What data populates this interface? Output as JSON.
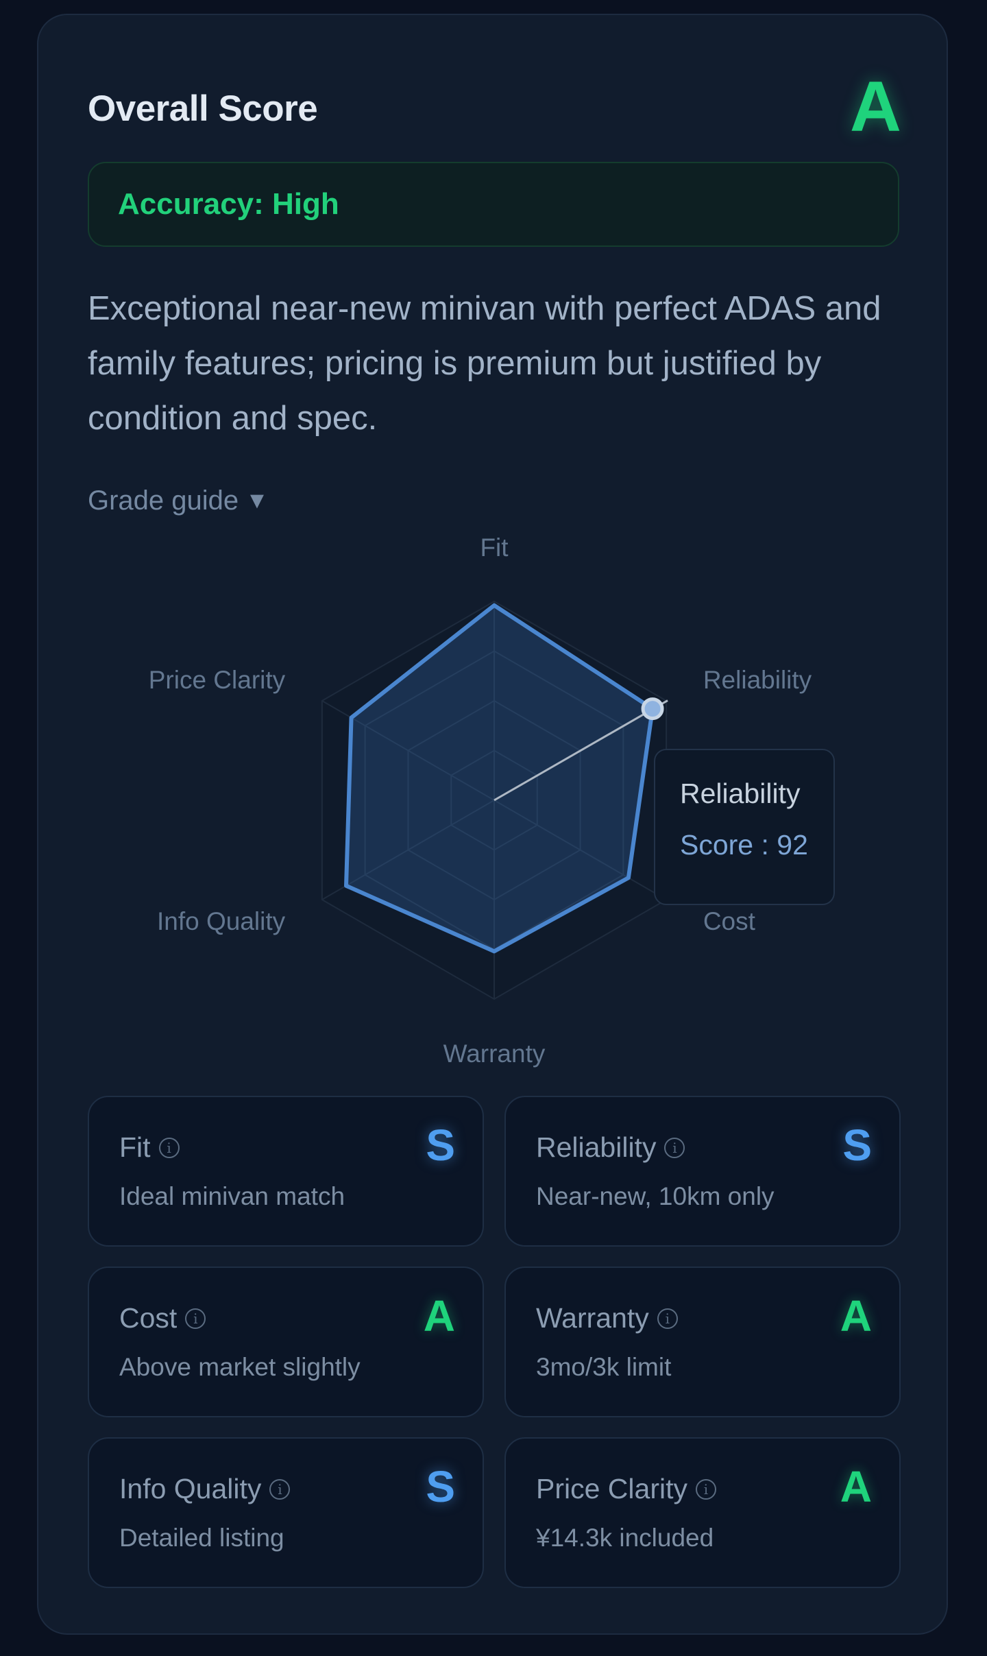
{
  "overall": {
    "title": "Overall Score",
    "grade": "A",
    "accuracy": "Accuracy: High",
    "summary": "Exceptional near-new minivan with perfect ADAS and family features; pricing is premium but justified by condition and spec.",
    "grade_guide_label": "Grade guide",
    "grade_guide_caret": "▼"
  },
  "chart_data": {
    "type": "radar",
    "axes": [
      "Fit",
      "Reliability",
      "Cost",
      "Warranty",
      "Info Quality",
      "Price Clarity"
    ],
    "values": [
      98,
      92,
      78,
      76,
      86,
      83
    ],
    "max": 100,
    "rings": 4,
    "active_point": "Reliability"
  },
  "tooltip": {
    "title": "Reliability",
    "score_text": "Score : 92"
  },
  "criteria": [
    {
      "name": "Fit",
      "desc": "Ideal minivan match",
      "grade": "S"
    },
    {
      "name": "Reliability",
      "desc": "Near-new, 10km only",
      "grade": "S"
    },
    {
      "name": "Cost",
      "desc": "Above market slightly",
      "grade": "A"
    },
    {
      "name": "Warranty",
      "desc": "3mo/3k limit",
      "grade": "A"
    },
    {
      "name": "Info Quality",
      "desc": "Detailed listing",
      "grade": "S"
    },
    {
      "name": "Price Clarity",
      "desc": "¥14.3k included",
      "grade": "A"
    }
  ],
  "colors": {
    "grade_S": "#4f9ef0",
    "grade_A": "#1fd37c",
    "radar_stroke": "#4a86cf"
  }
}
